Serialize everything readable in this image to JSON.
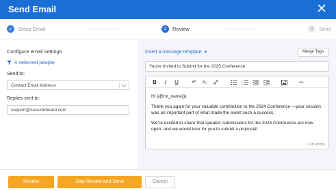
{
  "dialog": {
    "title": "Send Email"
  },
  "stepper": {
    "steps": [
      {
        "label": "Setup Email",
        "marker": "✓",
        "state": "complete"
      },
      {
        "label": "Review",
        "marker": "2",
        "state": "active"
      },
      {
        "label": "Send",
        "marker": "3",
        "state": "upcoming"
      }
    ]
  },
  "config": {
    "heading": "Configure email settings",
    "selected_people": "4 selected people",
    "send_to_label": "Send to:",
    "send_to_value": "Contact Email Address",
    "replies_label": "Replies sent to:",
    "replies_value": "support@sessionboard.com"
  },
  "message": {
    "template_label": "Insert a message template",
    "merge_tags_label": "Merge Tags",
    "subject": "You’re Invited to Submit for the 2025 Conference",
    "body": [
      "Hi {{{first_name}}},",
      "Thank you again for your valuable contribution to the 2024 Conference —your session was an important part of what made the event such a success.",
      "We’re excited to share that speaker submissions for the 2025 Conference are now open, and we would love for you to submit a proposal!"
    ],
    "word_count": "128 words"
  },
  "toolbar": {
    "bold": "B",
    "italic": "I",
    "underline": "U",
    "superscript": "x²",
    "subscript": "x₂",
    "more": "•••"
  },
  "footer": {
    "review_label": "Review",
    "skip_label": "Skip Review and Send",
    "cancel_label": "Cancel"
  },
  "colors": {
    "primary": "#1a6fd6",
    "link": "#2a6fdb",
    "accent": "#f5a623",
    "panel": "#f3f5f8"
  }
}
